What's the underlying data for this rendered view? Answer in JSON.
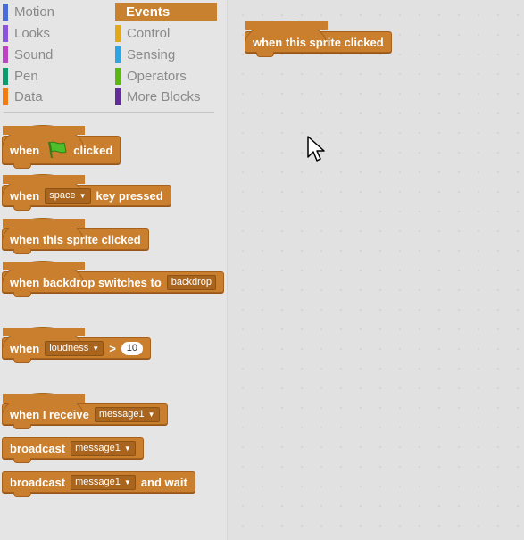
{
  "categories": [
    {
      "label": "Motion",
      "color": "#4a6cd4"
    },
    {
      "label": "Looks",
      "color": "#8a55d7"
    },
    {
      "label": "Sound",
      "color": "#bb42c3"
    },
    {
      "label": "Pen",
      "color": "#0e9a6c"
    },
    {
      "label": "Data",
      "color": "#ee7d16"
    },
    {
      "label": "Events",
      "color": "#c88330"
    },
    {
      "label": "Control",
      "color": "#e1a91a"
    },
    {
      "label": "Sensing",
      "color": "#2ca5e2"
    },
    {
      "label": "Operators",
      "color": "#5cb712"
    },
    {
      "label": "More Blocks",
      "color": "#632d99"
    }
  ],
  "blocks": {
    "green_flag": {
      "when": "when",
      "clicked": "clicked"
    },
    "key_pressed": {
      "when": "when",
      "key": "space",
      "rest": "key pressed"
    },
    "sprite_clicked": {
      "text": "when this sprite clicked"
    },
    "backdrop": {
      "text": "when backdrop switches to",
      "value": "backdrop"
    },
    "loudness": {
      "when": "when",
      "sensor": "loudness",
      "op": ">",
      "value": "10"
    },
    "receive": {
      "text": "when I receive",
      "message": "message1"
    },
    "broadcast": {
      "text": "broadcast",
      "message": "message1"
    },
    "broadcast_wait": {
      "text": "broadcast",
      "message": "message1",
      "rest": "and wait"
    }
  },
  "script": {
    "block": "when this sprite clicked"
  },
  "icons": {
    "flag": "green-flag-icon",
    "cursor": "mouse-cursor-icon"
  }
}
